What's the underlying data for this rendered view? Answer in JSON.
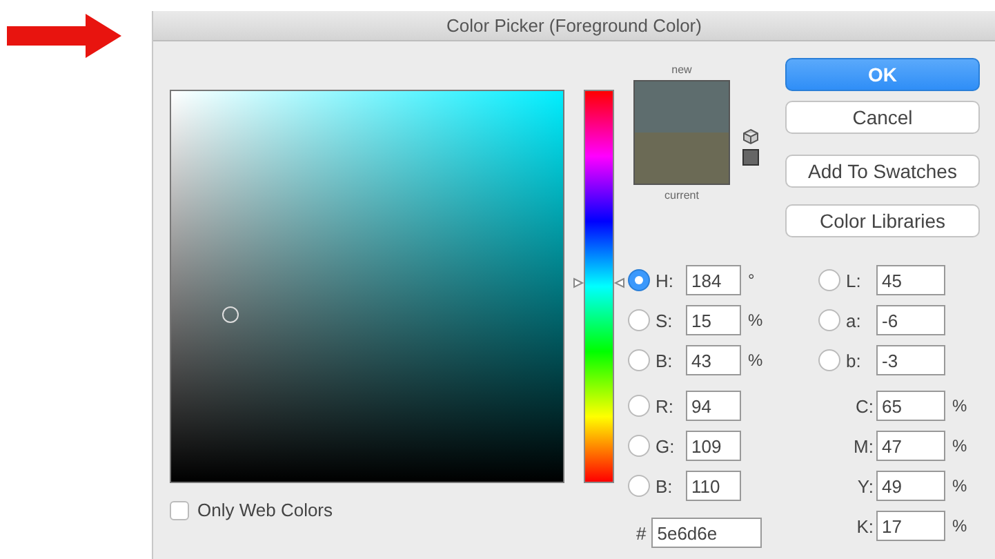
{
  "window": {
    "title": "Color Picker (Foreground Color)"
  },
  "hue_slider": {
    "level": 0.49
  },
  "preview": [
    {
      "label": "new",
      "color": "#5e6d6e"
    },
    {
      "label": "current",
      "color": "#6b6a55"
    }
  ],
  "buttons": [
    {
      "label": "OK",
      "kind": "primary"
    },
    {
      "label": "Cancel",
      "kind": "normal"
    },
    {
      "label": "Add To Swatches",
      "kind": "normal"
    },
    {
      "label": "Color Libraries",
      "kind": "normal"
    }
  ],
  "left_fields": [
    {
      "kind": "radio",
      "label": "H:",
      "value": "184",
      "unit": "°",
      "selected": true
    },
    {
      "kind": "radio",
      "label": "S:",
      "value": "15",
      "unit": "%",
      "selected": false
    },
    {
      "kind": "radio",
      "label": "B:",
      "value": "43",
      "unit": "%",
      "selected": false
    },
    {
      "kind": "radio",
      "label": "R:",
      "value": "94",
      "selected": false
    },
    {
      "kind": "radio",
      "label": "G:",
      "value": "109",
      "selected": false
    },
    {
      "kind": "radio",
      "label": "B:",
      "value": "110",
      "selected": false
    }
  ],
  "hex": {
    "label": "#",
    "value": "5e6d6e"
  },
  "right_fields": [
    {
      "kind": "radio",
      "label": "L:",
      "value": "45",
      "selected": false
    },
    {
      "kind": "radio",
      "label": "a:",
      "value": "-6",
      "selected": false
    },
    {
      "kind": "radio",
      "label": "b:",
      "value": "-3",
      "selected": false
    },
    {
      "kind": "plain",
      "label": "C:",
      "value": "65",
      "unit": "%"
    },
    {
      "kind": "plain",
      "label": "M:",
      "value": "47",
      "unit": "%"
    },
    {
      "kind": "plain",
      "label": "Y:",
      "value": "49",
      "unit": "%"
    },
    {
      "kind": "plain",
      "label": "K:",
      "value": "17",
      "unit": "%"
    }
  ],
  "only_web_colors": {
    "label": "Only Web Colors",
    "checked": false
  }
}
